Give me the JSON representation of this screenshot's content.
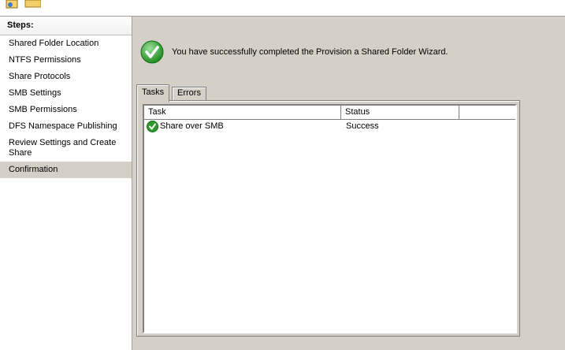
{
  "sidebar": {
    "title": "Steps:",
    "items": [
      {
        "label": "Shared Folder Location"
      },
      {
        "label": "NTFS Permissions"
      },
      {
        "label": "Share Protocols"
      },
      {
        "label": "SMB Settings"
      },
      {
        "label": "SMB Permissions"
      },
      {
        "label": "DFS Namespace Publishing"
      },
      {
        "label": "Review Settings and Create Share"
      },
      {
        "label": "Confirmation"
      }
    ],
    "selected": "Confirmation"
  },
  "main": {
    "message": "You have successfully completed the Provision a Shared Folder Wizard.",
    "message_icon": "success-check-icon",
    "tabs": [
      {
        "label": "Tasks",
        "active": true
      },
      {
        "label": "Errors",
        "active": false
      }
    ],
    "table": {
      "columns": [
        "Task",
        "Status"
      ],
      "rows": [
        {
          "task": "Share over SMB",
          "status": "Success",
          "icon": "success-check-icon"
        }
      ]
    }
  },
  "colors": {
    "background": "#d4d0c8",
    "success_green": "#3aa53a"
  }
}
